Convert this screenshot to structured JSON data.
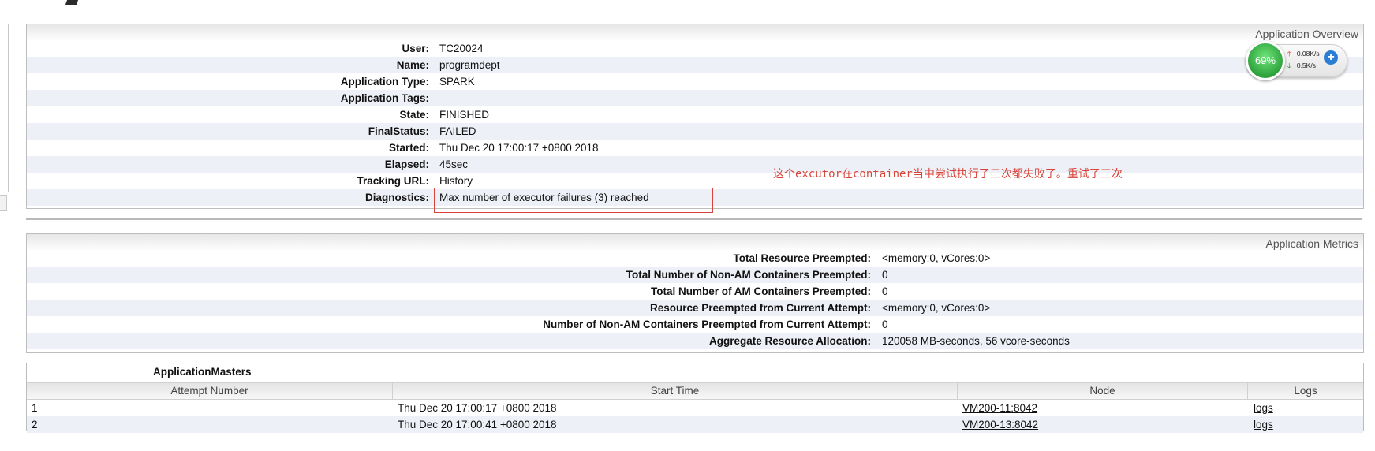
{
  "overview": {
    "title": "Application Overview",
    "rows": [
      {
        "label": "User:",
        "value": "TC20024"
      },
      {
        "label": "Name:",
        "value": "programdept"
      },
      {
        "label": "Application Type:",
        "value": "SPARK"
      },
      {
        "label": "Application Tags:",
        "value": ""
      },
      {
        "label": "State:",
        "value": "FINISHED"
      },
      {
        "label": "FinalStatus:",
        "value": "FAILED"
      },
      {
        "label": "Started:",
        "value": "Thu Dec 20 17:00:17 +0800 2018"
      },
      {
        "label": "Elapsed:",
        "value": "45sec"
      },
      {
        "label": "Tracking URL:",
        "value": "History"
      },
      {
        "label": "Diagnostics:",
        "value": "Max number of executor failures (3) reached"
      }
    ]
  },
  "annotation": "这个excutor在container当中尝试执行了三次都失败了。重试了三次",
  "net_widget": {
    "percent": "69%",
    "upload": "0.08K/s",
    "download": "0.5K/s",
    "plus": "+"
  },
  "metrics": {
    "title": "Application Metrics",
    "rows": [
      {
        "label": "Total Resource Preempted:",
        "value": "<memory:0, vCores:0>"
      },
      {
        "label": "Total Number of Non-AM Containers Preempted:",
        "value": "0"
      },
      {
        "label": "Total Number of AM Containers Preempted:",
        "value": "0"
      },
      {
        "label": "Resource Preempted from Current Attempt:",
        "value": "<memory:0, vCores:0>"
      },
      {
        "label": "Number of Non-AM Containers Preempted from Current Attempt:",
        "value": "0"
      },
      {
        "label": "Aggregate Resource Allocation:",
        "value": "120058 MB-seconds, 56 vcore-seconds"
      }
    ]
  },
  "masters": {
    "title": "ApplicationMasters",
    "columns": [
      "Attempt Number",
      "Start Time",
      "Node",
      "Logs"
    ],
    "rows": [
      {
        "attempt": "1",
        "start": "Thu Dec 20 17:00:17 +0800 2018",
        "node": "VM200-11:8042",
        "logs": "logs"
      },
      {
        "attempt": "2",
        "start": "Thu Dec 20 17:00:41 +0800 2018",
        "node": "VM200-13:8042",
        "logs": "logs"
      }
    ]
  },
  "colors": {
    "annotation": "#d9443a",
    "row_alt": "#eef0f7",
    "gauge": "#2ea13b",
    "plus_button": "#2a7fd4"
  }
}
